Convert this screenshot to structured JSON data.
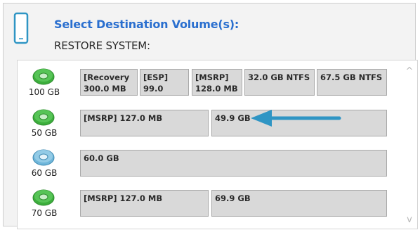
{
  "header": {
    "title": "Select Destination Volume(s):",
    "subtitle": "RESTORE SYSTEM:"
  },
  "colors": {
    "title": "#2a6fcf",
    "disk_green": "#3cae3c",
    "disk_blue": "#6fb6da",
    "arrow": "#2f95c4"
  },
  "disks": [
    {
      "size_label": "100 GB",
      "icon": "green-disk-icon",
      "partitions": [
        {
          "label": "[Recovery\n300.0 MB"
        },
        {
          "label": "[ESP] 99.0\nMB"
        },
        {
          "label": "[MSRP]\n128.0 MB"
        },
        {
          "label": "32.0 GB NTFS"
        },
        {
          "label": "67.5 GB NTFS"
        }
      ]
    },
    {
      "size_label": "50 GB",
      "icon": "green-disk-icon",
      "partitions": [
        {
          "label": "[MSRP] 127.0 MB"
        },
        {
          "label": "49.9 GB"
        }
      ]
    },
    {
      "size_label": "60 GB",
      "icon": "blue-disk-icon",
      "partitions": [
        {
          "label": "60.0 GB"
        }
      ]
    },
    {
      "size_label": "70 GB",
      "icon": "green-disk-icon",
      "partitions": [
        {
          "label": "[MSRP] 127.0 MB"
        },
        {
          "label": "69.9 GB"
        }
      ]
    }
  ],
  "scrollbar": {
    "up_icon": "chevron-up-icon",
    "down_icon": "chevron-down-icon",
    "up_glyph": "^",
    "down_glyph": "v"
  },
  "annotation": {
    "icon": "arrow-left-icon"
  }
}
